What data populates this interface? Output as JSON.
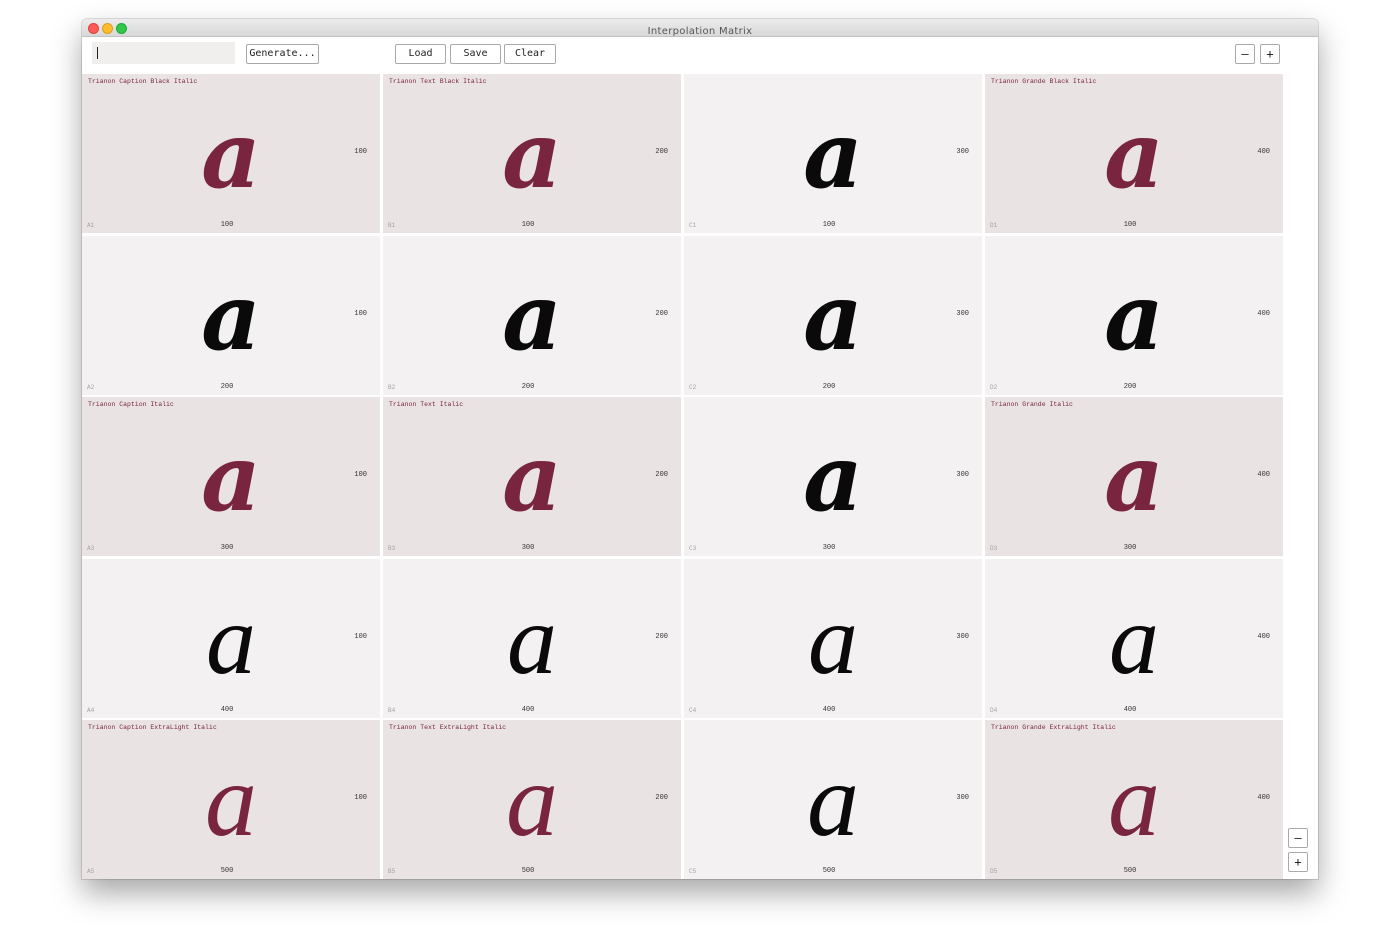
{
  "window": {
    "title": "Interpolation Matrix"
  },
  "toolbar": {
    "name_value": "",
    "generate_label": "Generate...",
    "load_label": "Load",
    "save_label": "Save",
    "clear_label": "Clear",
    "zoom_out_label": "–",
    "zoom_in_label": "+"
  },
  "side_zoom": {
    "zoom_out_label": "–",
    "zoom_in_label": "+"
  },
  "colors": {
    "master": "#7a2540",
    "interpolated": "#0a0a0a",
    "master_bg": "#e9e3e3",
    "cell_bg": "#f4f1f2"
  },
  "glyph": "a",
  "rows": [
    {
      "cells": [
        {
          "id": "A1",
          "name": "Trianon Caption Black Italic",
          "x": "100",
          "y": "100",
          "master": true
        },
        {
          "id": "B1",
          "name": "Trianon Text Black Italic",
          "x": "100",
          "y": "200",
          "master": true
        },
        {
          "id": "C1",
          "name": "",
          "x": "100",
          "y": "300",
          "master": false
        },
        {
          "id": "D1",
          "name": "Trianon Grande Black Italic",
          "x": "100",
          "y": "400",
          "master": true
        }
      ]
    },
    {
      "cells": [
        {
          "id": "A2",
          "name": "",
          "x": "200",
          "y": "100",
          "master": false
        },
        {
          "id": "B2",
          "name": "",
          "x": "200",
          "y": "200",
          "master": false
        },
        {
          "id": "C2",
          "name": "",
          "x": "200",
          "y": "300",
          "master": false
        },
        {
          "id": "D2",
          "name": "",
          "x": "200",
          "y": "400",
          "master": false
        }
      ]
    },
    {
      "cells": [
        {
          "id": "A3",
          "name": "Trianon Caption Italic",
          "x": "300",
          "y": "100",
          "master": true
        },
        {
          "id": "B3",
          "name": "Trianon Text Italic",
          "x": "300",
          "y": "200",
          "master": true
        },
        {
          "id": "C3",
          "name": "",
          "x": "300",
          "y": "300",
          "master": false
        },
        {
          "id": "D3",
          "name": "Trianon Grande Italic",
          "x": "300",
          "y": "400",
          "master": true
        }
      ]
    },
    {
      "cells": [
        {
          "id": "A4",
          "name": "",
          "x": "400",
          "y": "100",
          "master": false
        },
        {
          "id": "B4",
          "name": "",
          "x": "400",
          "y": "200",
          "master": false
        },
        {
          "id": "C4",
          "name": "",
          "x": "400",
          "y": "300",
          "master": false
        },
        {
          "id": "D4",
          "name": "",
          "x": "400",
          "y": "400",
          "master": false
        }
      ]
    },
    {
      "cells": [
        {
          "id": "A5",
          "name": "Trianon Caption ExtraLight Italic",
          "x": "500",
          "y": "100",
          "master": true
        },
        {
          "id": "B5",
          "name": "Trianon Text ExtraLight Italic",
          "x": "500",
          "y": "200",
          "master": true
        },
        {
          "id": "C5",
          "name": "",
          "x": "500",
          "y": "300",
          "master": false
        },
        {
          "id": "D5",
          "name": "Trianon Grande ExtraLight Italic",
          "x": "500",
          "y": "400",
          "master": true
        }
      ]
    }
  ]
}
